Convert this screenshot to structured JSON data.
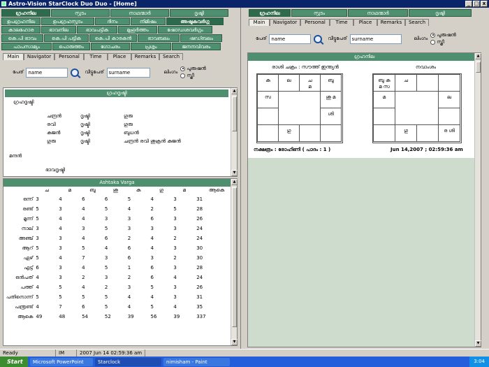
{
  "window": {
    "title": "Astro-Vision StarClock Duo Duo - [Home]",
    "min_label": "_",
    "max_label": "□",
    "close_label": "x"
  },
  "left": {
    "tab_rows": [
      [
        "ഗ്രഹനില",
        "സ്ഫുടം",
        "നാഥന്മാർ",
        "ദൃഷ്ടി"
      ],
      [
        "ഉപഗ്രഹനില",
        "ഉപഗ്രഹസ്ഫുടം",
        "ദിനം",
        "നിമിഷം",
        "അഷ്ടകവർഗ്ഗ"
      ],
      [
        "കാലഹോര",
        "ഭാവനില",
        "ഭാവപട്ടിക",
        "മുഹൂർത്തം",
        "ഷോഡശവർഗ്ഗം"
      ],
      [
        "കെ.പി ഭാവം",
        "കെ.പി പട്ടിക",
        "കെ.പി കാരകൻ",
        "ഭാവബലം",
        "ഷഡ്ബലം"
      ],
      [
        "പാപസാമ്യം",
        "പൊരുത്തം",
        "ഗോചരം",
        "പ്രശ്നം",
        "ജനനവിവരം"
      ]
    ],
    "sub_tabs": [
      "Main",
      "Navigator",
      "Personal",
      "Time",
      "Place",
      "Remarks",
      "Search"
    ],
    "form": {
      "name_label": "പേര്",
      "name_value": "name",
      "surname_label": "വീട്ടുപേര്",
      "surname_value": "surname",
      "gender_label": "ലിംഗം",
      "male_label": "പുരുഷൻ",
      "female_label": "സ്ത്രീ"
    },
    "drishti": {
      "header": "ഗ്രഹദൃഷ്ടി",
      "intro": "ഗ്രഹദൃഷ്ടി",
      "rows": [
        [
          "ചന്ദ്രൻ",
          "ദൃഷ്ടി",
          "ഗുരു"
        ],
        [
          "രവി",
          "ദൃഷ്ടി",
          "ഗുരു"
        ],
        [
          "കുജൻ",
          "ദൃഷ്ടി",
          "ബുധൻ"
        ],
        [
          "ഗുരു",
          "ദൃഷ്ടി",
          "ചന്ദ്രൻ രവി ശുക്രൻ കുജൻ"
        ]
      ],
      "mandan": "മന്ദൻ",
      "bhava": "ഭാവദൃഷ്ടി"
    },
    "ashtaka": {
      "header": "Ashtaka Varga",
      "columns": [
        "ച",
        "മ",
        "ബു",
        "ശു",
        "കു",
        "ഗു",
        "മ",
        "ആകെ"
      ],
      "rows": [
        {
          "label": "ഒന്ന്",
          "values": [
            "3",
            "4",
            "6",
            "6",
            "5",
            "4",
            "3",
            "31"
          ]
        },
        {
          "label": "രണ്ട്",
          "values": [
            "5",
            "3",
            "4",
            "5",
            "4",
            "2",
            "5",
            "28"
          ]
        },
        {
          "label": "മൂന്ന്",
          "values": [
            "5",
            "4",
            "4",
            "3",
            "3",
            "6",
            "3",
            "26"
          ]
        },
        {
          "label": "നാല്",
          "values": [
            "3",
            "4",
            "3",
            "5",
            "3",
            "3",
            "3",
            "24"
          ]
        },
        {
          "label": "അഞ്ച്",
          "values": [
            "3",
            "3",
            "4",
            "6",
            "2",
            "4",
            "2",
            "24"
          ]
        },
        {
          "label": "ആറ്",
          "values": [
            "5",
            "3",
            "5",
            "4",
            "6",
            "4",
            "3",
            "30"
          ]
        },
        {
          "label": "ഏഴ്",
          "values": [
            "5",
            "4",
            "7",
            "3",
            "6",
            "3",
            "2",
            "30"
          ]
        },
        {
          "label": "എട്ട്",
          "values": [
            "6",
            "3",
            "4",
            "5",
            "1",
            "6",
            "3",
            "28"
          ]
        },
        {
          "label": "ഒൻപത്",
          "values": [
            "4",
            "3",
            "2",
            "3",
            "2",
            "6",
            "4",
            "24"
          ]
        },
        {
          "label": "പത്ത്",
          "values": [
            "4",
            "5",
            "4",
            "2",
            "3",
            "5",
            "3",
            "26"
          ]
        },
        {
          "label": "പതിനൊന്ന്",
          "values": [
            "5",
            "5",
            "5",
            "5",
            "4",
            "4",
            "3",
            "31"
          ]
        },
        {
          "label": "പന്ത്രണ്ട്",
          "values": [
            "4",
            "7",
            "6",
            "5",
            "4",
            "5",
            "4",
            "35"
          ]
        },
        {
          "label": "ആകെ",
          "values": [
            "49",
            "48",
            "54",
            "52",
            "39",
            "56",
            "39",
            "337"
          ]
        }
      ]
    }
  },
  "right": {
    "tabs": [
      "ഗ്രഹനില",
      "സ്ഫുടം",
      "നാഥന്മാർ",
      "ദൃഷ്ടി"
    ],
    "sub_tabs": [
      "Main",
      "Navigator",
      "Personal",
      "Time",
      "Place",
      "Remarks",
      "Search"
    ],
    "form": {
      "name_label": "പേര്",
      "name_value": "name",
      "surname_label": "വീട്ടുപേര്",
      "surname_value": "surname",
      "gender_label": "ലിംഗം",
      "male_label": "പുരുഷൻ",
      "female_label": "സ്ത്രീ"
    },
    "panel_header": "ഗ്രഹനില",
    "rasi_title": "രാശി ചക്രം : സൗത്ത് ഇന്ത്യൻ",
    "navamsa_title": "നവാംശം",
    "rasi_cells": {
      "c0": "കു",
      "c1": "ല",
      "c2": "ച\nമ",
      "c3": "ബു",
      "c4": "സ",
      "c5": "ശു മ",
      "c6": "",
      "c7": "ശി",
      "c8": "",
      "c9": "ഗു",
      "c10": "",
      "c11": ""
    },
    "navamsa_cells": {
      "c0": "ബു കു\nമ സ",
      "c1": "ച",
      "c2": "",
      "c3": "",
      "c4": "മ",
      "c5": "ല",
      "c6": "",
      "c7": "",
      "c8": "",
      "c9": "ഗു",
      "c10": "",
      "c11": "ര ശി"
    },
    "nakshatra": "നക്ഷത്രം : രോഹിണി ( പാദം : 1 )",
    "datetime": "Jun 14,2007 ; 02:59:36 am"
  },
  "status": {
    "ready": "Ready",
    "mode": "IM",
    "datetime": "2007 Jun 14 02:59:36 am"
  },
  "taskbar": {
    "start": "Start",
    "apps": [
      "Microsoft PowerPoint",
      "Starclock",
      "nimisham - Paint"
    ],
    "clock": "3:04"
  },
  "colors": {
    "accent_green": "#4d8f6e",
    "title_blue": "#0a246a",
    "taskbar_blue": "#245edb"
  }
}
